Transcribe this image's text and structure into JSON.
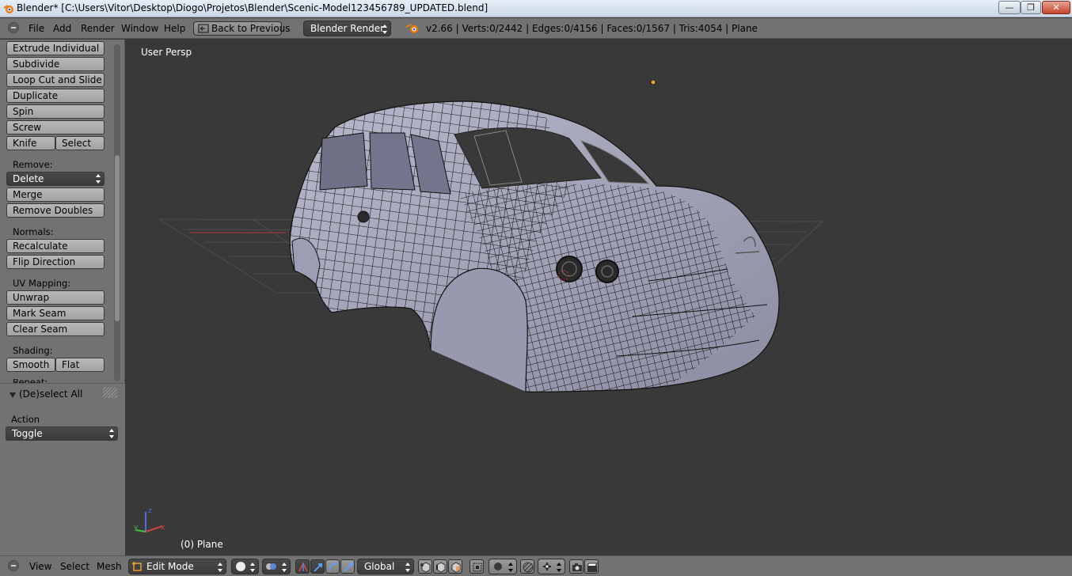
{
  "window": {
    "title": "Blender* [C:\\Users\\Vitor\\Desktop\\Diogo\\Projetos\\Blender\\Scenic-Model123456789_UPDATED.blend]",
    "minimize": "—",
    "maximize": "❐",
    "close": "✕"
  },
  "infobar": {
    "menus": [
      "File",
      "Add",
      "Render",
      "Window",
      "Help"
    ],
    "back_button": "Back to Previous",
    "render_engine": "Blender Render",
    "stats": "v2.66 | Verts:0/2442 | Edges:0/4156 | Faces:0/1567 | Tris:4054 | Plane"
  },
  "toolshelf": {
    "tools_top": [
      "Extrude Individual",
      "Subdivide",
      "Loop Cut and Slide",
      "Duplicate",
      "Spin",
      "Screw"
    ],
    "knife": "Knife",
    "knife_select": "Select",
    "remove_label": "Remove:",
    "delete": "Delete",
    "merge": "Merge",
    "remove_doubles": "Remove Doubles",
    "normals_label": "Normals:",
    "recalculate": "Recalculate",
    "flip_direction": "Flip Direction",
    "uv_label": "UV Mapping:",
    "unwrap": "Unwrap",
    "mark_seam": "Mark Seam",
    "clear_seam": "Clear Seam",
    "shading_label": "Shading:",
    "smooth": "Smooth",
    "flat": "Flat",
    "repeat_label": "Repeat:"
  },
  "redo_panel": {
    "title": "(De)select All",
    "action_label": "Action",
    "action_value": "Toggle"
  },
  "viewport": {
    "view_name": "User Persp",
    "object_name": "(0) Plane",
    "axis_x": "x",
    "axis_y": "y",
    "axis_z": "z"
  },
  "bottombar": {
    "menus": [
      "View",
      "Select",
      "Mesh"
    ],
    "mode": "Edit Mode",
    "orientation": "Global"
  },
  "colors": {
    "header": "#727272",
    "viewport": "#393939",
    "mesh": "#a9a9bd",
    "accent": "#f0a030"
  }
}
